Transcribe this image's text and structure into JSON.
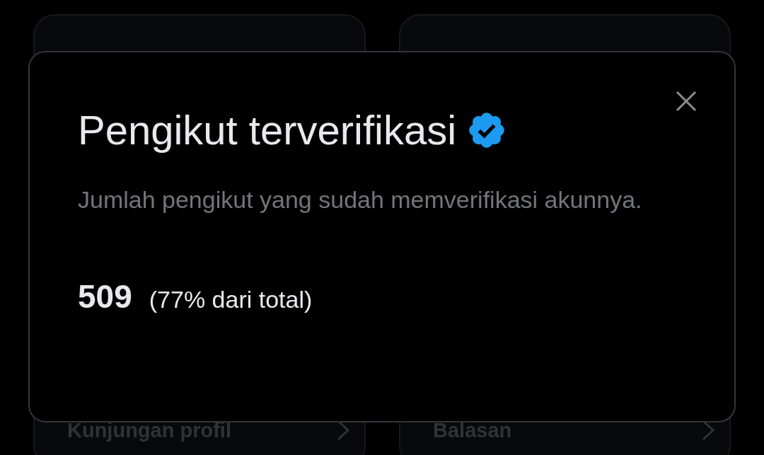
{
  "background_cards": [
    {
      "label": "Kunjungan profil"
    },
    {
      "label": "Balasan"
    }
  ],
  "dialog": {
    "title": "Pengikut terverifikasi",
    "description": "Jumlah pengikut yang sudah memverifikasi akunnya.",
    "count": "509",
    "share": "(77% dari total)"
  }
}
